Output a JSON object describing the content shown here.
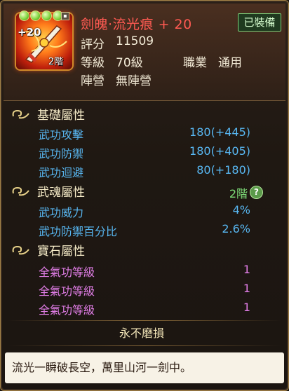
{
  "item": {
    "enhance": "+20",
    "tier_badge": "2階",
    "name": "劍魄·流光痕 + 20",
    "equipped_label": "已裝備",
    "score_label": "評分",
    "score_value": "11509",
    "level_label": "等級",
    "level_value": "70級",
    "job_label": "職業",
    "job_value": "通用",
    "faction_label": "陣營",
    "faction_value": "無陣營",
    "gem_slots": 4,
    "colors": {
      "name": "#ff5a52",
      "attr_blue": "#58b7f2",
      "attr_purple": "#e27ee8",
      "green": "#7fe07a"
    }
  },
  "sections": {
    "basic": {
      "title": "基礎屬性",
      "rows": [
        {
          "label": "武功攻擊",
          "value": "180(+445)"
        },
        {
          "label": "武功防禦",
          "value": "180(+405)"
        },
        {
          "label": "武功迴避",
          "value": "80(+180)"
        }
      ]
    },
    "soul": {
      "title": "武魂屬性",
      "tier": "2階",
      "help_icon": "?",
      "rows": [
        {
          "label": "武功威力",
          "value": "4%"
        },
        {
          "label": "武功防禦百分比",
          "value": "2.6%"
        }
      ]
    },
    "gem": {
      "title": "寶石屬性",
      "rows": [
        {
          "label": "全氣功等級",
          "value": "1"
        },
        {
          "label": "全氣功等級",
          "value": "1"
        },
        {
          "label": "全氣功等級",
          "value": "1"
        }
      ]
    }
  },
  "durability": "永不磨損",
  "description": "流光一瞬破長空，萬里山河一劍中。"
}
